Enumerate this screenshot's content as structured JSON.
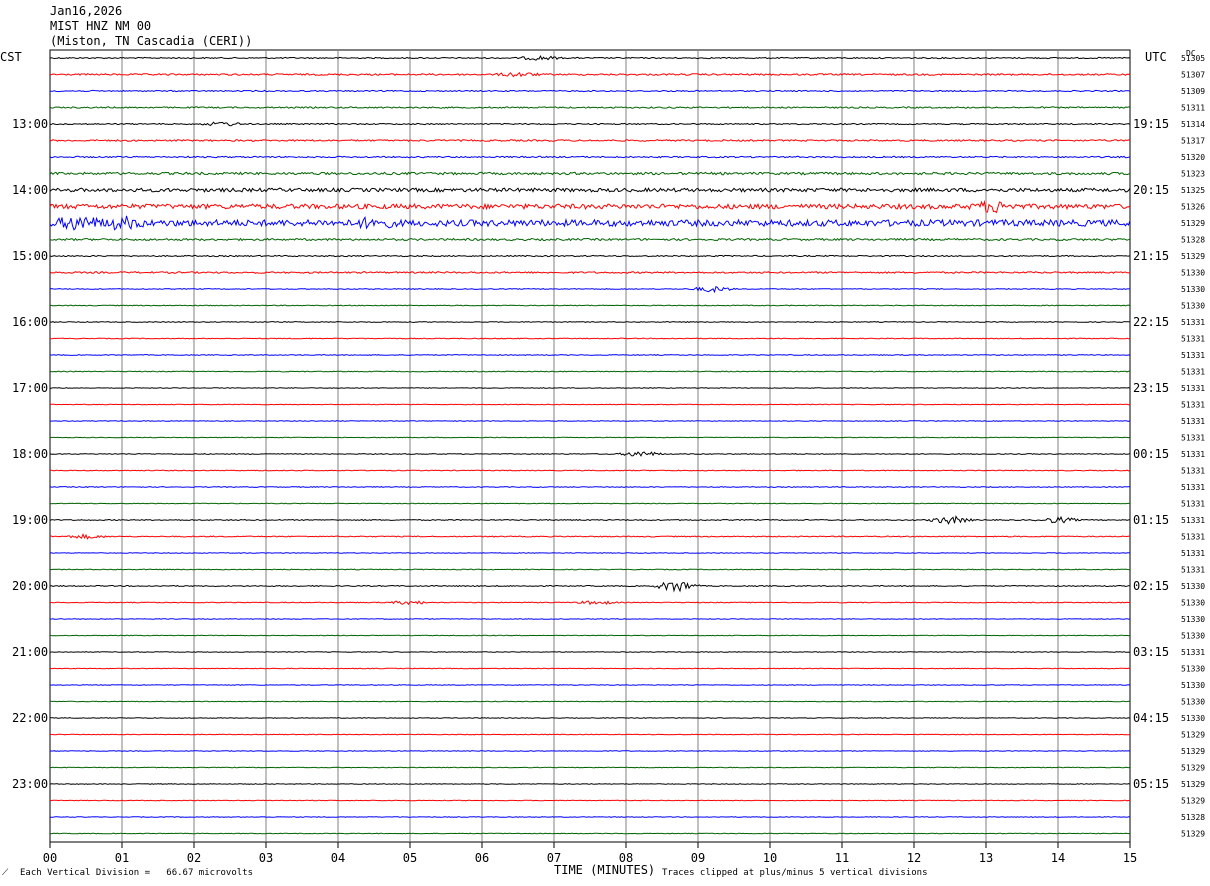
{
  "header": {
    "date": "Jan16,2026",
    "station": "MIST HNZ NM 00",
    "location": "(Miston, TN Cascadia (CERI))"
  },
  "chart_data": {
    "type": "line",
    "title": "Jan16,2026 MIST HNZ NM 00 (Miston, TN Cascadia (CERI))",
    "xlabel": "TIME (MINUTES)",
    "x_ticks": [
      "00",
      "01",
      "02",
      "03",
      "04",
      "05",
      "06",
      "07",
      "08",
      "09",
      "10",
      "11",
      "12",
      "13",
      "14",
      "15"
    ],
    "xlim": [
      0,
      15
    ],
    "left_axis_label": "CST",
    "right_axis_label": "UTC",
    "dc_label": "DC",
    "left_times": [
      "13:00",
      "14:00",
      "15:00",
      "16:00",
      "17:00",
      "18:00",
      "19:00",
      "20:00",
      "21:00",
      "22:00",
      "23:00"
    ],
    "right_times": [
      "19:15",
      "20:15",
      "21:15",
      "22:15",
      "23:15",
      "00:15",
      "01:15",
      "02:15",
      "03:15",
      "04:15",
      "05:15"
    ],
    "dc_values": [
      "51305",
      "51307",
      "51309",
      "51311",
      "51314",
      "51317",
      "51320",
      "51323",
      "51325",
      "51326",
      "51329",
      "51328",
      "51329",
      "51330",
      "51330",
      "51330",
      "51331",
      "51331",
      "51331",
      "51331",
      "51331",
      "51331",
      "51331",
      "51331",
      "51331",
      "51331",
      "51331",
      "51331",
      "51331",
      "51331",
      "51331",
      "51331",
      "51330",
      "51330",
      "51330",
      "51330",
      "51331",
      "51330",
      "51330",
      "51330",
      "51330",
      "51329",
      "51329",
      "51329",
      "51329",
      "51329",
      "51328",
      "51329"
    ],
    "trace_colors": [
      "#000000",
      "#ff0000",
      "#0000ff",
      "#006400"
    ],
    "grid": true,
    "gridline_color": "#808080",
    "scale_note": "Each Vertical Division =   66.67 microvolts",
    "clip_note": "Traces clipped at plus/minus 5 vertical divisions",
    "noise_level": [
      0.6,
      0.8,
      0.6,
      0.7,
      0.6,
      0.8,
      0.7,
      1.2,
      1.8,
      2.4,
      3.2,
      1.0,
      0.6,
      0.8,
      0.4,
      0.4,
      0.4,
      0.4,
      0.4,
      0.4,
      0.3,
      0.3,
      0.3,
      0.3,
      0.4,
      0.4,
      0.4,
      0.3,
      0.5,
      0.5,
      0.3,
      0.4,
      0.5,
      0.4,
      0.3,
      0.3,
      0.3,
      0.3,
      0.3,
      0.3,
      0.3,
      0.3,
      0.3,
      0.3,
      0.3,
      0.3,
      0.3,
      0.3
    ],
    "events": [
      {
        "trace": 9,
        "minute": 13.1,
        "amplitude": 5
      },
      {
        "trace": 10,
        "minute": 0.4,
        "amplitude": 7
      },
      {
        "trace": 10,
        "minute": 1.0,
        "amplitude": 5
      },
      {
        "trace": 10,
        "minute": 4.5,
        "amplitude": 4
      },
      {
        "trace": 14,
        "minute": 9.2,
        "amplitude": 3
      },
      {
        "trace": 24,
        "minute": 8.2,
        "amplitude": 3
      },
      {
        "trace": 28,
        "minute": 12.5,
        "amplitude": 4
      },
      {
        "trace": 28,
        "minute": 14.0,
        "amplitude": 3
      },
      {
        "trace": 32,
        "minute": 8.7,
        "amplitude": 6
      },
      {
        "trace": 33,
        "minute": 5.0,
        "amplitude": 2
      },
      {
        "trace": 33,
        "minute": 7.6,
        "amplitude": 2
      },
      {
        "trace": 0,
        "minute": 6.8,
        "amplitude": 2
      },
      {
        "trace": 1,
        "minute": 6.5,
        "amplitude": 2
      },
      {
        "trace": 4,
        "minute": 2.4,
        "amplitude": 2
      },
      {
        "trace": 29,
        "minute": 0.5,
        "amplitude": 2
      }
    ]
  }
}
